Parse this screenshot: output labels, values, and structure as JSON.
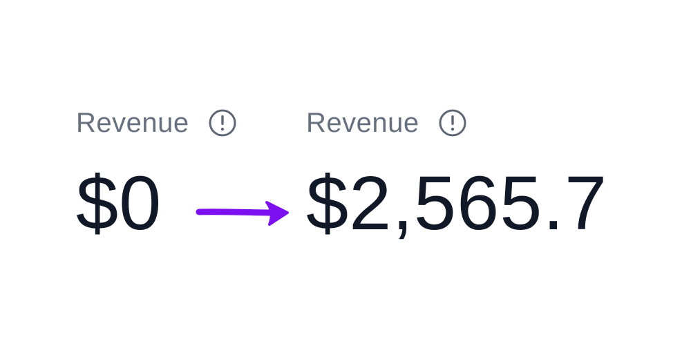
{
  "metrics": {
    "before": {
      "label": "Revenue",
      "value": "$0",
      "icon": "info-circle-icon"
    },
    "after": {
      "label": "Revenue",
      "value": "$2,565.7",
      "icon": "info-circle-icon"
    }
  },
  "annotation": {
    "arrow_icon": "right-arrow-icon",
    "arrow_color": "#7c10f0"
  },
  "colors": {
    "label": "#67707e",
    "value": "#111827",
    "background": "#ffffff"
  }
}
